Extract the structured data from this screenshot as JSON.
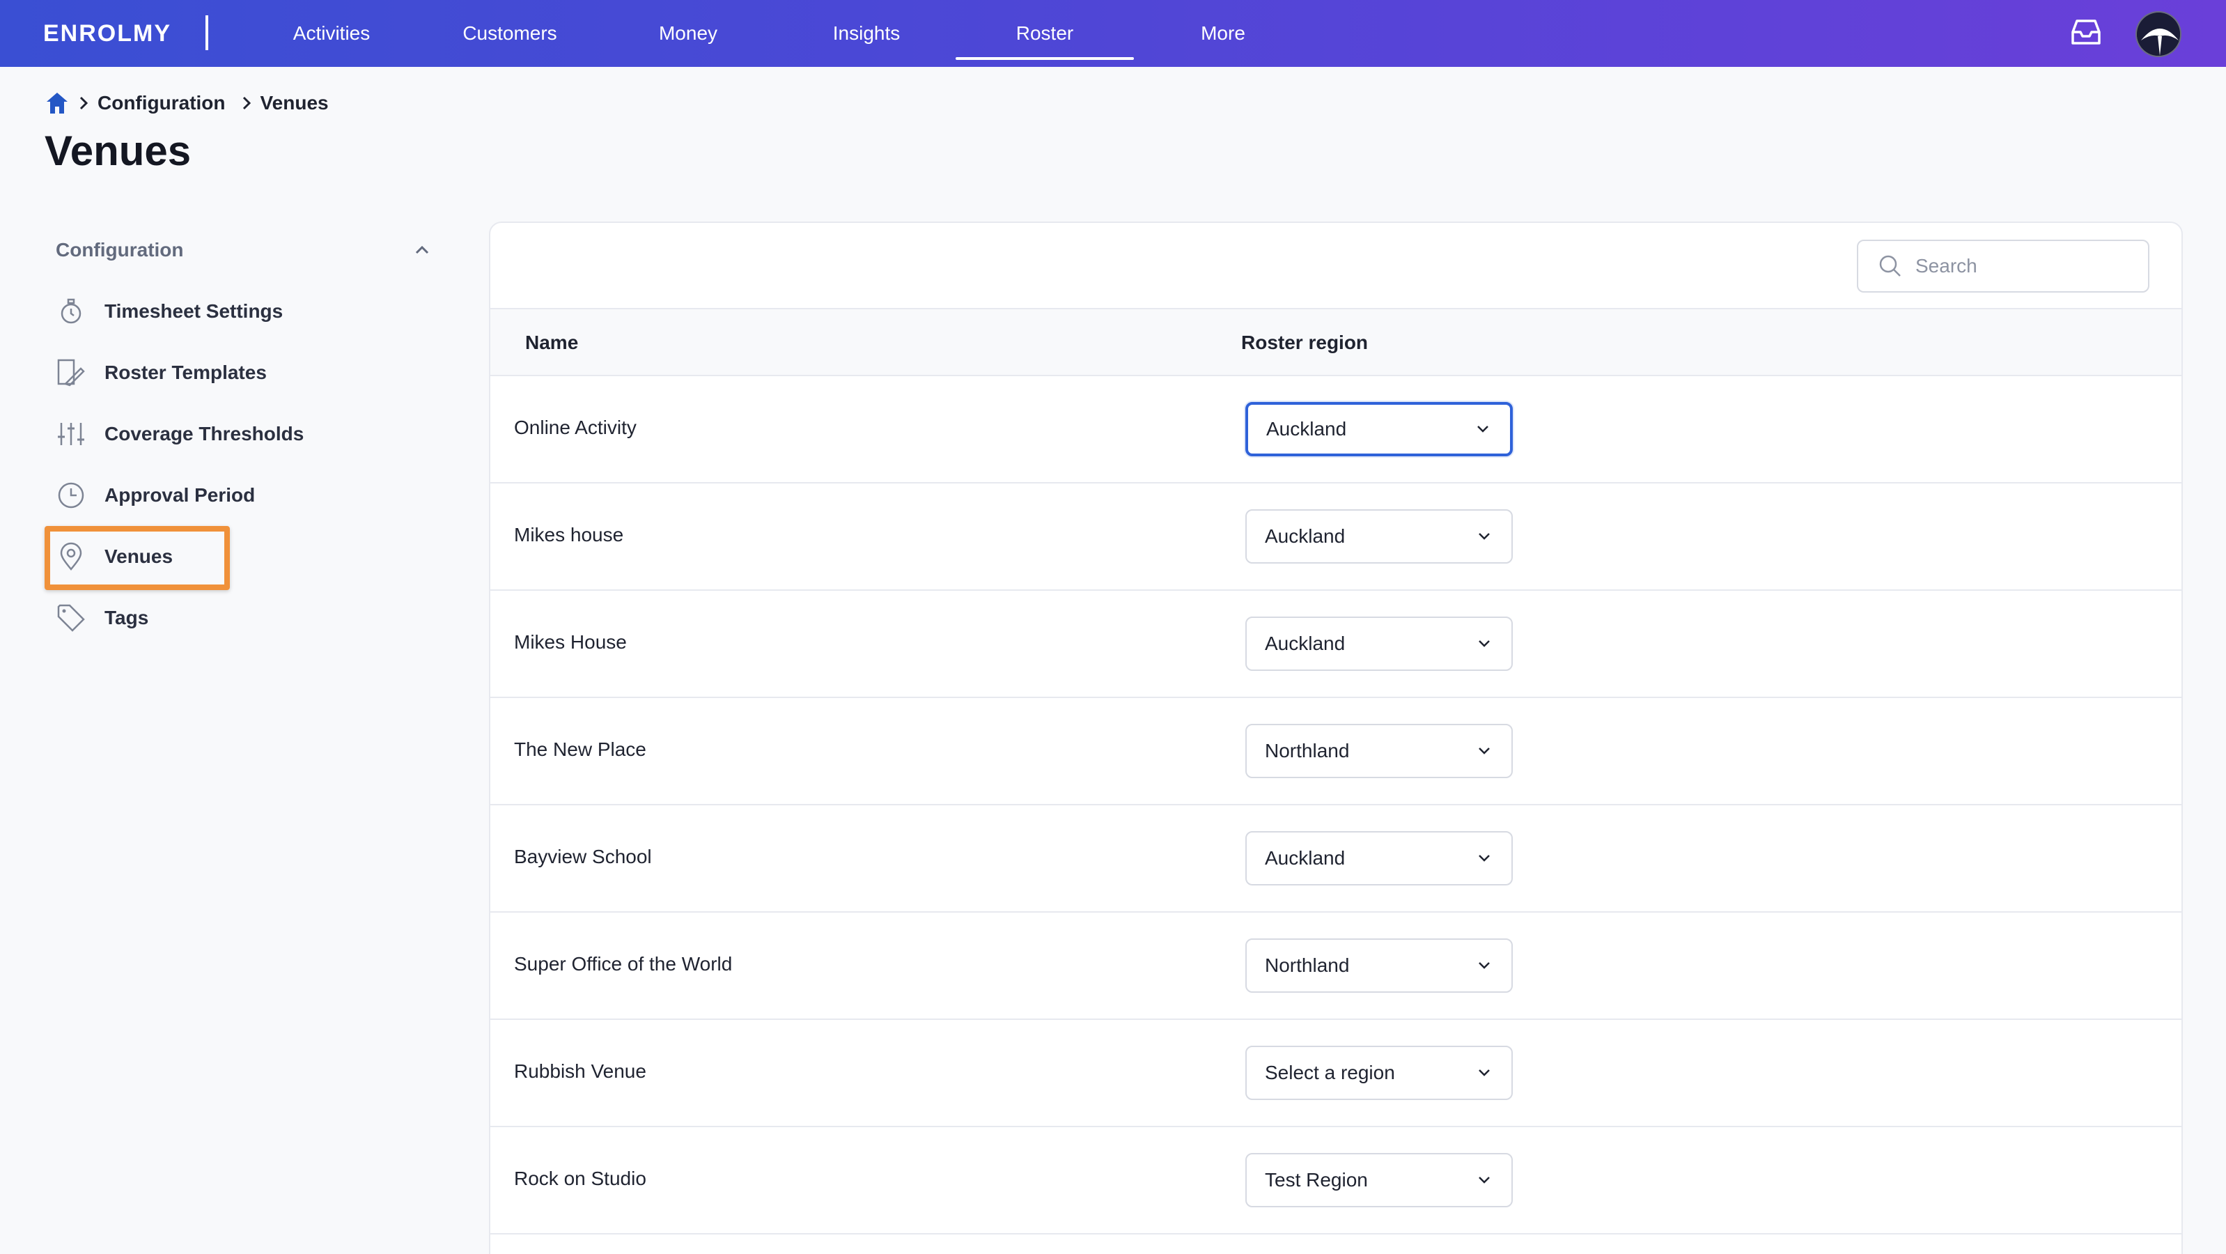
{
  "app": {
    "logo": "ENROLMY"
  },
  "nav": {
    "tabs": [
      {
        "label": "Activities"
      },
      {
        "label": "Customers"
      },
      {
        "label": "Money"
      },
      {
        "label": "Insights"
      },
      {
        "label": "Roster",
        "active": true
      },
      {
        "label": "More"
      }
    ]
  },
  "breadcrumb": {
    "items": [
      "Configuration",
      "Venues"
    ]
  },
  "page": {
    "title": "Venues"
  },
  "sidebar": {
    "section_label": "Configuration",
    "items": [
      {
        "label": "Timesheet Settings",
        "icon": "stopwatch-icon"
      },
      {
        "label": "Roster Templates",
        "icon": "template-icon"
      },
      {
        "label": "Coverage Thresholds",
        "icon": "sliders-icon"
      },
      {
        "label": "Approval Period",
        "icon": "clock-icon"
      },
      {
        "label": "Venues",
        "icon": "location-pin-icon",
        "highlighted": true
      },
      {
        "label": "Tags",
        "icon": "tag-icon"
      }
    ]
  },
  "search": {
    "placeholder": "Search",
    "value": ""
  },
  "table": {
    "columns": [
      "Name",
      "Roster region"
    ],
    "rows": [
      {
        "name": "Online Activity",
        "region": "Auckland",
        "focused": true
      },
      {
        "name": "Mikes house",
        "region": "Auckland"
      },
      {
        "name": "Mikes House",
        "region": "Auckland"
      },
      {
        "name": "The New Place",
        "region": "Northland"
      },
      {
        "name": "Bayview School",
        "region": "Auckland"
      },
      {
        "name": "Super Office of the World",
        "region": "Northland"
      },
      {
        "name": "Rubbish Venue",
        "region": "Select a region"
      },
      {
        "name": "Rock on Studio",
        "region": "Test Region"
      }
    ]
  },
  "colors": {
    "topbar_start": "#3a4fd3",
    "topbar_end": "#6a3fd9",
    "highlight": "#f0913a",
    "focus": "#2f62d9"
  }
}
